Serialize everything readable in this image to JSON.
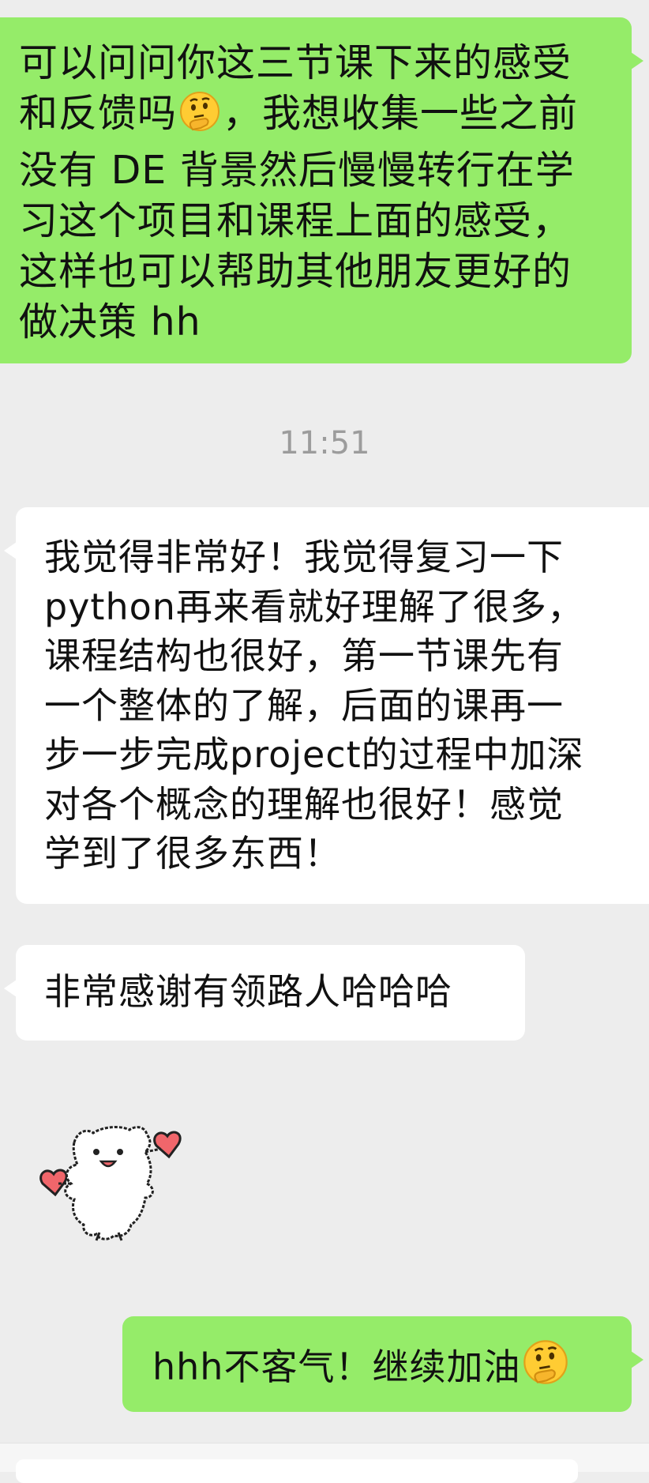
{
  "conversation": {
    "messages": [
      {
        "direction": "outgoing",
        "text_before_emoji": "可以问问你这三节课下来的感受\n和反馈吗",
        "emoji": "thinking-face-emoji",
        "text_after_emoji": "，我想收集一些之前\n没有 DE 背景然后慢慢转行在学\n习这个项目和课程上面的感受，\n这样也可以帮助其他朋友更好的\n做决策 hh"
      },
      {
        "direction": "timestamp",
        "text": "11:51"
      },
      {
        "direction": "incoming",
        "text": "我觉得非常好！我觉得复习一下\npython再来看就好理解了很多，\n课程结构也很好，第一节课先有\n一个整体的了解，后面的课再一\n步一步完成project的过程中加深\n对各个概念的理解也很好！感觉\n学到了很多东西！"
      },
      {
        "direction": "incoming",
        "text": "非常感谢有领路人哈哈哈"
      },
      {
        "direction": "incoming",
        "sticker": "bear-holding-hearts-sticker"
      },
      {
        "direction": "outgoing",
        "text": "hhh不客气！继续加油",
        "emoji": "thinking-face-emoji"
      }
    ]
  },
  "colors": {
    "background": "#ededed",
    "outgoing_bubble": "#95ec69",
    "incoming_bubble": "#ffffff",
    "timestamp_text": "#9c9c9c",
    "sticker_heart": "#f0666b"
  }
}
